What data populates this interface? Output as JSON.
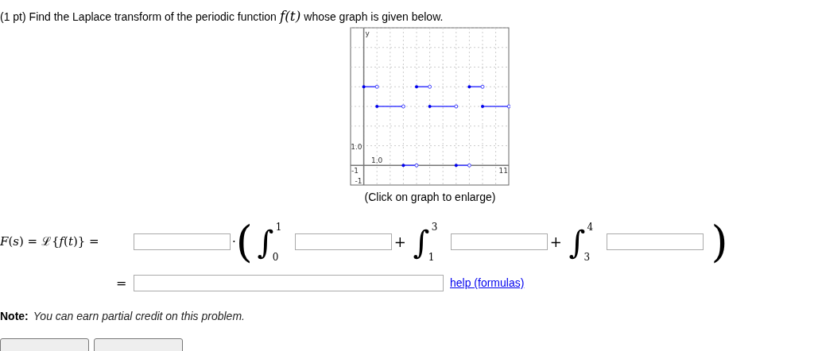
{
  "problem": {
    "points": "(1 pt)",
    "text_before": "Find the Laplace transform of the periodic function",
    "function": "f(t)",
    "text_after": "whose graph is given below."
  },
  "graph": {
    "axis_labels": [
      "y",
      "1.0",
      "1.0",
      "-1",
      "11",
      "-1"
    ],
    "caption": "(Click on graph to enlarge)"
  },
  "equation": {
    "lhs": "*F*(*s*) = ℒ{*f*(*t*)} =",
    "dot": "·",
    "open_paren": "(",
    "close_paren": ")",
    "plus": "+",
    "integrals": [
      {
        "sign": "∫",
        "upper": "1",
        "lower": "0"
      },
      {
        "sign": "∫",
        "upper": "3",
        "lower": "1"
      },
      {
        "sign": "∫",
        "upper": "4",
        "lower": "3"
      }
    ],
    "equals": "=",
    "help_link": "help (formulas)"
  },
  "note": {
    "label": "Note:",
    "text": "You can earn partial credit on this problem."
  },
  "buttons": [
    {
      "kind": "button"
    },
    {
      "kind": "button"
    }
  ]
}
